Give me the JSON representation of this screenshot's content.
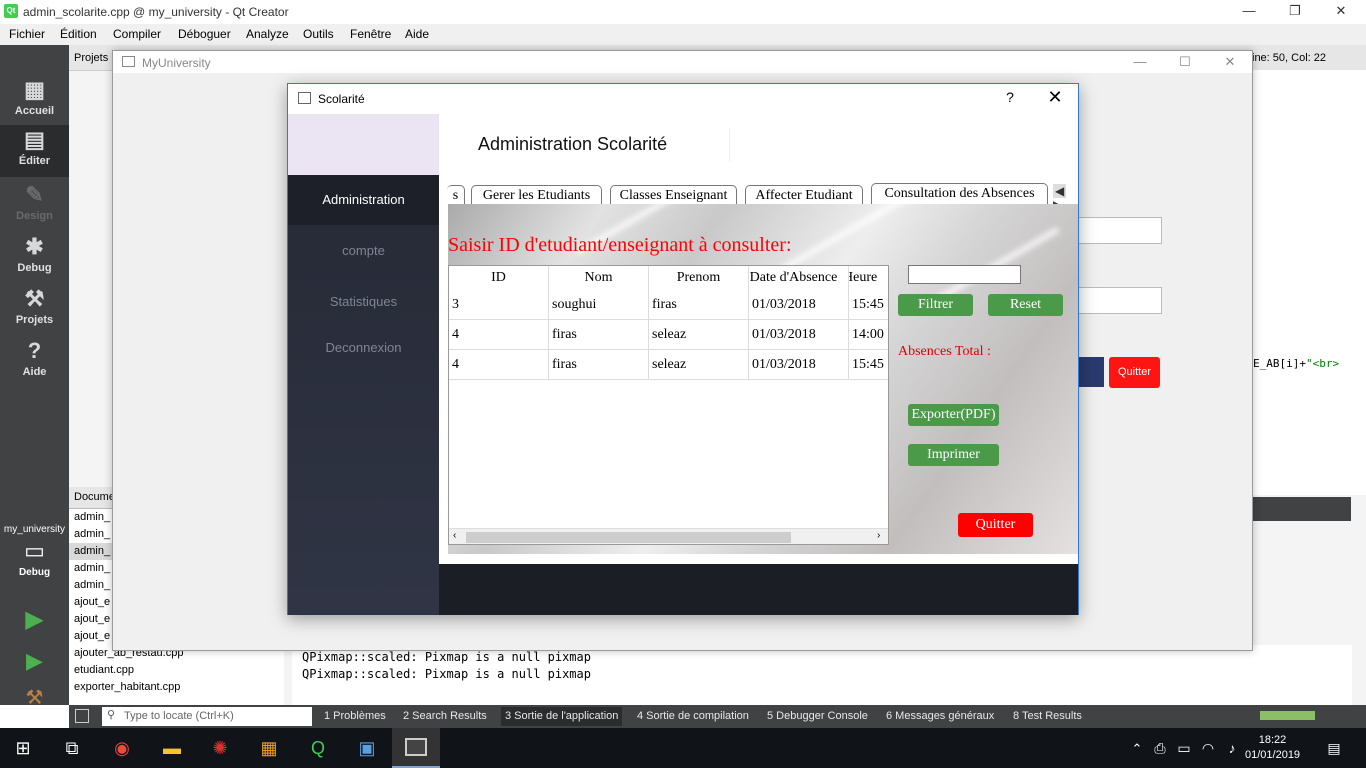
{
  "qt_creator": {
    "title": "admin_scolarite.cpp @ my_university - Qt Creator",
    "menu": [
      "Fichier",
      "Édition",
      "Compiler",
      "Déboguer",
      "Analyze",
      "Outils",
      "Fenêtre",
      "Aide"
    ],
    "modes": [
      {
        "label": "Accueil",
        "icon": "grid-icon"
      },
      {
        "label": "Éditer",
        "icon": "edit-doc-icon"
      },
      {
        "label": "Design",
        "icon": "pen-icon"
      },
      {
        "label": "Debug",
        "icon": "bug-icon"
      },
      {
        "label": "Projets",
        "icon": "wrench-icon"
      },
      {
        "label": "Aide",
        "icon": "help-icon"
      }
    ],
    "projects_label": "Projets",
    "line_col": "ine: 50, Col: 22",
    "documents_header": "Docume",
    "documents": [
      "admin_",
      "admin_",
      "admin_",
      "admin_",
      "admin_",
      "ajout_e",
      "ajout_e",
      "ajout_e",
      "ajouter_ab_restau.cpp",
      "etudiant.cpp",
      "exporter_habitant.cpp"
    ],
    "kit": {
      "project": "my_university",
      "mode": "Debug"
    },
    "output_lines": [
      "QPixmap::scaled: Pixmap is a null pixmap",
      "QPixmap::scaled: Pixmap is a null pixmap"
    ],
    "code_snippet": {
      "prefix": "E_AB[i]+",
      "string": "\"<br>"
    },
    "locate_placeholder": "Type to locate (Ctrl+K)",
    "status_tabs": [
      "1  Problèmes",
      "2  Search Results",
      "3  Sortie de l'application",
      "4  Sortie de compilation",
      "5  Debugger Console",
      "6  Messages généraux",
      "8  Test Results"
    ],
    "bg_quit_label": "Quitter"
  },
  "myuniversity": {
    "title": "MyUniversity"
  },
  "dialog": {
    "title": "Scolarité",
    "help": "?",
    "close": "✕",
    "header_title": "Administration Scolarité",
    "sidebar": [
      "Administration",
      "compte",
      "Statistiques",
      "Deconnexion"
    ],
    "tabs": [
      "s",
      "Gerer les Etudiants",
      "Classes Enseignant",
      "Affecter Etudiant",
      "Consultation des Absences"
    ],
    "prompt": "Saisir ID d'etudiant/enseignant à consulter:",
    "table": {
      "headers": [
        "ID",
        "Nom",
        "Prenom",
        "Date d'Absence",
        "Heure"
      ],
      "rows": [
        [
          "3",
          "soughui",
          "firas",
          "01/03/2018",
          "15:45"
        ],
        [
          "4",
          "firas",
          "seleaz",
          "01/03/2018",
          "14:00"
        ],
        [
          "4",
          "firas",
          "seleaz",
          "01/03/2018",
          "15:45"
        ]
      ]
    },
    "filter_value": "",
    "buttons": {
      "filter": "Filtrer",
      "reset": "Reset",
      "export": "Exporter(PDF)",
      "print": "Imprimer",
      "quit": "Quitter"
    },
    "absences_total": "Absences Total :"
  },
  "taskbar": {
    "time": "18:22",
    "date": "01/01/2019"
  },
  "colors": {
    "sidebar_bg": "#262a36",
    "accent_red": "#ff0000",
    "button_green": "#4a9a4a",
    "qt_dark": "#404244"
  }
}
